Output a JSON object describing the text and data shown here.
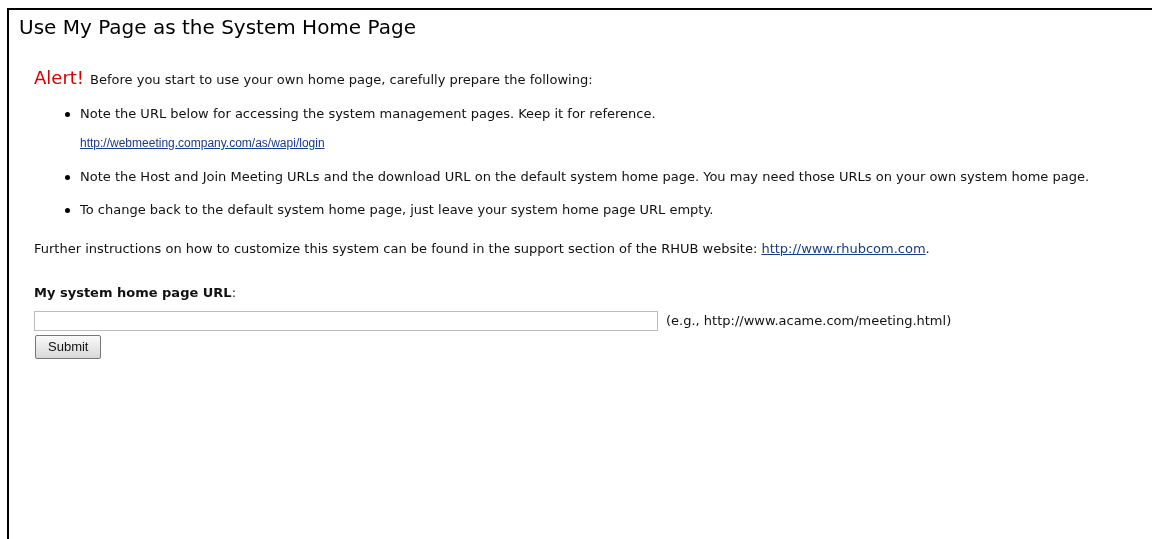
{
  "title": "Use My Page as the System Home Page",
  "alert": {
    "label": "Alert!",
    "text": "Before you start to use your own home page, carefully prepare the following:"
  },
  "bullets": [
    {
      "text": "Note the URL below for accessing the system management pages. Keep it for reference.",
      "link": "http://webmeeting.company.com/as/wapi/login"
    },
    {
      "text": "Note the Host and Join Meeting URLs and the download URL on the default system home page. You may need those URLs on your own system home page."
    },
    {
      "text": "To change back to the default system home page, just leave your system home page URL empty."
    }
  ],
  "further": {
    "text": "Further instructions on how to customize this system can be found in the support section of the RHUB website:",
    "link": "http://www.rhubcom.com",
    "after": "."
  },
  "form": {
    "label": "My system home page URL",
    "label_suffix": ":",
    "hint": "(e.g., http://www.acame.com/meeting.html)",
    "submit": "Submit"
  }
}
